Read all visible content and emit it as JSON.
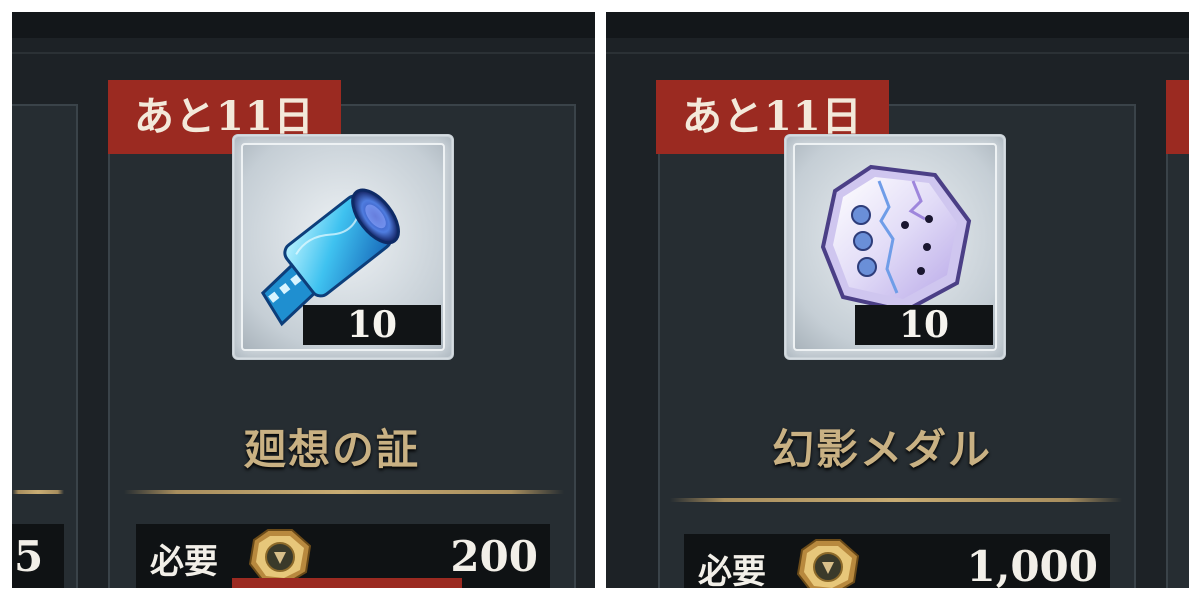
{
  "panels": [
    {
      "badge": "あと11日",
      "item_icon": "film-canister-icon",
      "quantity": "10",
      "item_name": "廻想の証",
      "cost_label": "必要",
      "currency_icon": "gold-medal-coin-icon",
      "cost_value": "200",
      "neighbor_cost_value": "5"
    },
    {
      "badge": "あと11日",
      "item_icon": "phantom-medal-icon",
      "quantity": "10",
      "item_name": "幻影メダル",
      "cost_label": "必要",
      "currency_icon": "gold-medal-coin-icon",
      "cost_value": "1,000"
    }
  ],
  "colors": {
    "background": "#1d2226",
    "badge_red": "#9b2a21",
    "name_gold": "#c9b183",
    "text_white": "#f2efe8"
  }
}
